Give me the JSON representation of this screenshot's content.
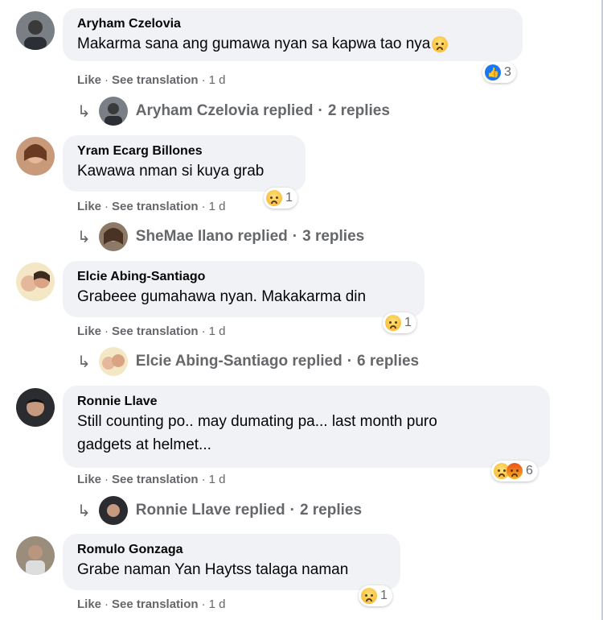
{
  "actions": {
    "like": "Like",
    "see_translation": "See translation",
    "separator": "·"
  },
  "comments": [
    {
      "author": "Aryham Czelovia",
      "text": "Makarma sana ang gumawa nyan sa kapwa tao nya",
      "reactions": {
        "icons": [
          "like-icon"
        ],
        "count": "3"
      },
      "time": "1 d",
      "reply": {
        "name": "Aryham Czelovia",
        "verb": "replied",
        "count": "2 replies"
      }
    },
    {
      "author": "Yram Ecarg Billones",
      "text": "Kawawa nman si kuya grab",
      "reactions": {
        "icons": [
          "sad-icon"
        ],
        "count": "1"
      },
      "time": "1 d",
      "reply": {
        "name": "SheMae Ilano",
        "verb": "replied",
        "count": "3 replies"
      }
    },
    {
      "author": "Elcie Abing-Santiago",
      "text": "Grabeee gumahawa nyan. Makakarma din",
      "reactions": {
        "icons": [
          "sad-icon"
        ],
        "count": "1"
      },
      "time": "1 d",
      "reply": {
        "name": "Elcie Abing-Santiago",
        "verb": "replied",
        "count": "6 replies"
      }
    },
    {
      "author": "Ronnie Llave",
      "text_line1": "Still counting po.. may dumating pa... last month puro",
      "text_line2": "gadgets at helmet...",
      "reactions": {
        "icons": [
          "sad-icon",
          "angry-icon"
        ],
        "count": "6"
      },
      "time": "1 d",
      "reply": {
        "name": "Ronnie Llave",
        "verb": "replied",
        "count": "2 replies"
      }
    },
    {
      "author": "Romulo Gonzaga",
      "text": "Grabe naman Yan Haytss talaga naman",
      "reactions": {
        "icons": [
          "sad-icon"
        ],
        "count": "1"
      },
      "time": "1 d"
    }
  ],
  "colors": {
    "bubble": "#f0f2f5",
    "secondary_text": "#65676b",
    "like_blue": "#1877f2"
  }
}
